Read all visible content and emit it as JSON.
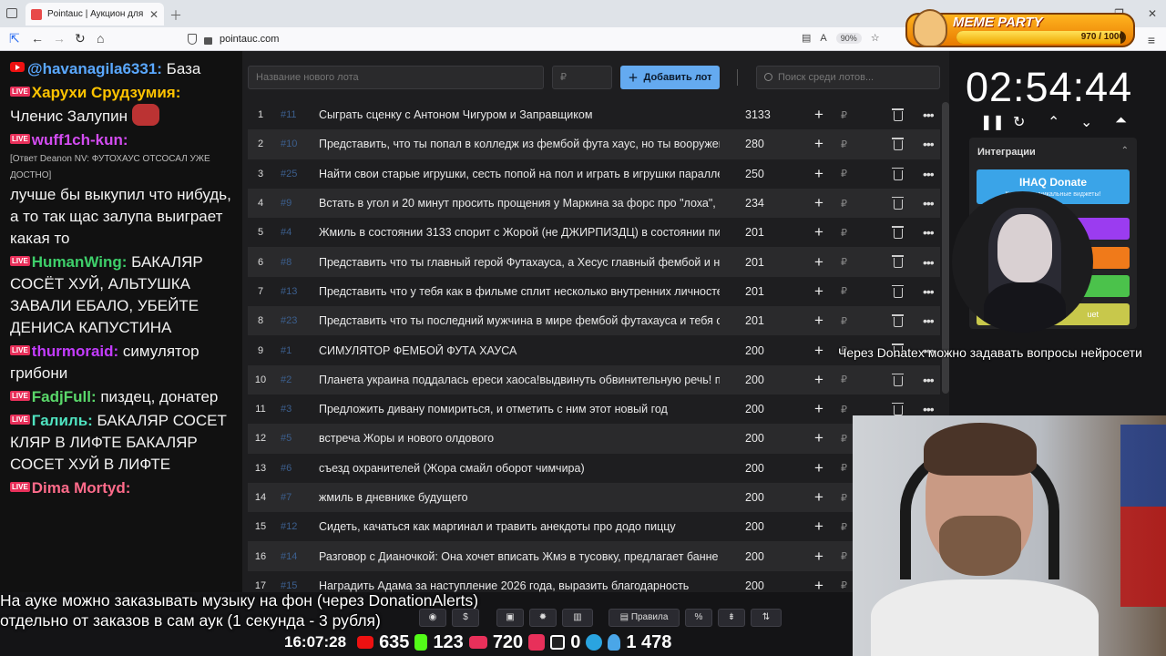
{
  "browser": {
    "tab_title": "Pointauc | Аукцион для стримеров",
    "url": "pointauc.com",
    "zoom": "90%"
  },
  "meme_party": {
    "title": "MEME PARTY",
    "count": "970 / 1000",
    "progress": 0.97
  },
  "chat": [
    {
      "prefix": "yt",
      "user": "@havanagila6331:",
      "user_color": "#5aa8ff",
      "text": " База"
    },
    {
      "prefix": "live",
      "user": "Харухи Срудзумия:",
      "user_color": "#ffc400",
      "text": " Членис Залупин",
      "emote": "#b33"
    },
    {
      "prefix": "live",
      "user": "wuff1ch-kun:",
      "user_color": "#d24cf0",
      "reply": "[Ответ Deanon NV: ФУТОХАУС ОТСОСАЛ УЖЕ ДОСТНО]",
      "text": "лучше бы выкупил что нибудь, а то так щас залупа выиграет какая то"
    },
    {
      "prefix": "live",
      "user": "HumanWing:",
      "user_color": "#3ecf6a",
      "text": " БАКАЛЯР СОСЁТ ХУЙ, АЛЬТУШКА ЗАВАЛИ ЕБАЛО, УБЕЙТЕ ДЕНИСА КАПУСТИНА"
    },
    {
      "prefix": "live",
      "user": "thurmoraid:",
      "user_color": "#c33cff",
      "text": " симулятор грибони"
    },
    {
      "prefix": "live",
      "user": "FadjFull:",
      "user_color": "#5ad86a",
      "text": " пиздец, донатер"
    },
    {
      "prefix": "live",
      "user": "Галиль:",
      "user_color": "#4fe3c0",
      "text": " БАКАЛЯР СОСЕТ КЛЯР В ЛИФТЕ БАКАЛЯР СОСЕТ ХУЙ В ЛИФТЕ"
    },
    {
      "prefix": "live",
      "user": "Dima Mortyd:",
      "user_color": "#ff6b8a",
      "text": ""
    }
  ],
  "toolbar": {
    "lot_placeholder": "Название нового лота",
    "amount_placeholder": "₽",
    "add_label": "Добавить лот",
    "search_placeholder": "Поиск среди лотов..."
  },
  "lots": [
    {
      "n": "1",
      "id": "#11",
      "title": "Сыграть сценку с Антоном Чигуром и Заправщиком",
      "amount": "3133"
    },
    {
      "n": "2",
      "id": "#10",
      "title": "Представить, что ты попал в колледж из фембой фута хаус, но ты вооружен",
      "amount": "280"
    },
    {
      "n": "3",
      "id": "#25",
      "title": "Найти свои старые игрушки, сесть попой на пол и играть в игрушки паралле",
      "amount": "250"
    },
    {
      "n": "4",
      "id": "#9",
      "title": "Встать в угол и 20 минут просить прощения у Маркина за форс про \"лоха\", ч",
      "amount": "234"
    },
    {
      "n": "5",
      "id": "#4",
      "title": "Жмиль в состоянии 3133 спорит с Жорой (не ДЖИРПИЗДЦ) в состоянии пи",
      "amount": "201"
    },
    {
      "n": "6",
      "id": "#8",
      "title": "Представить что ты главный герой Футахауса, а Хесус главный фембой и на",
      "amount": "201"
    },
    {
      "n": "7",
      "id": "#13",
      "title": "Представить что у тебя как в фильме сплит несколько внутренних личносте",
      "amount": "201"
    },
    {
      "n": "8",
      "id": "#23",
      "title": "Представить что ты последний мужчина в мире фембой футахауса и тебя ох",
      "amount": "201"
    },
    {
      "n": "9",
      "id": "#1",
      "title": "СИМУЛЯТОР ФЕМБОЙ ФУТА ХАУСА",
      "amount": "200"
    },
    {
      "n": "10",
      "id": "#2",
      "title": "Планета украина поддалась ереси хаоса!выдвинуть обвинительную речь! по",
      "amount": "200"
    },
    {
      "n": "11",
      "id": "#3",
      "title": "Предложить дивану помириться, и отметить с ним этот новый год",
      "amount": "200"
    },
    {
      "n": "12",
      "id": "#5",
      "title": "встреча Жоры и нового олдового",
      "amount": "200"
    },
    {
      "n": "13",
      "id": "#6",
      "title": "съезд охранителей (Жора смайл оборот чимчира)",
      "amount": "200"
    },
    {
      "n": "14",
      "id": "#7",
      "title": "жмиль в дневнике будущего",
      "amount": "200"
    },
    {
      "n": "15",
      "id": "#12",
      "title": "Сидеть, качаться как маргинал и травить анекдоты про додо пиццу",
      "amount": "200"
    },
    {
      "n": "16",
      "id": "#14",
      "title": "Разговор с Дианочкой: Она хочет вписать Жмэ в тусовку, предлагает банне",
      "amount": "200"
    },
    {
      "n": "17",
      "id": "#15",
      "title": "Наградить Адама за наступление 2026 года, выразить благодарность",
      "amount": "200"
    }
  ],
  "timer": {
    "value": "02:54:44"
  },
  "integrations": {
    "title": "Интеграции",
    "donate_label": "IHAQ Donate",
    "donate_sub": "Красивые уникальные виджеты!",
    "bottom_label": "uet",
    "colors": [
      "#9b3cf0",
      "#f07a1a",
      "#4bc24b",
      "#c8c84b"
    ]
  },
  "overlay": {
    "donatex": "Через Donatex можно задавать вопросы нейросети",
    "music_line1": "На ауке можно заказывать музыку на фон (через DonationAlerts)",
    "music_line2": "отдельно от заказов в сам аук (1 секунда - 3 рубля)"
  },
  "bottom_buttons": {
    "rules": "Правила",
    "percent": "%"
  },
  "stats": {
    "clock": "16:07:28",
    "youtube": "635",
    "kick": "123",
    "vk": "720",
    "rutube": "0",
    "total": "1 478"
  }
}
